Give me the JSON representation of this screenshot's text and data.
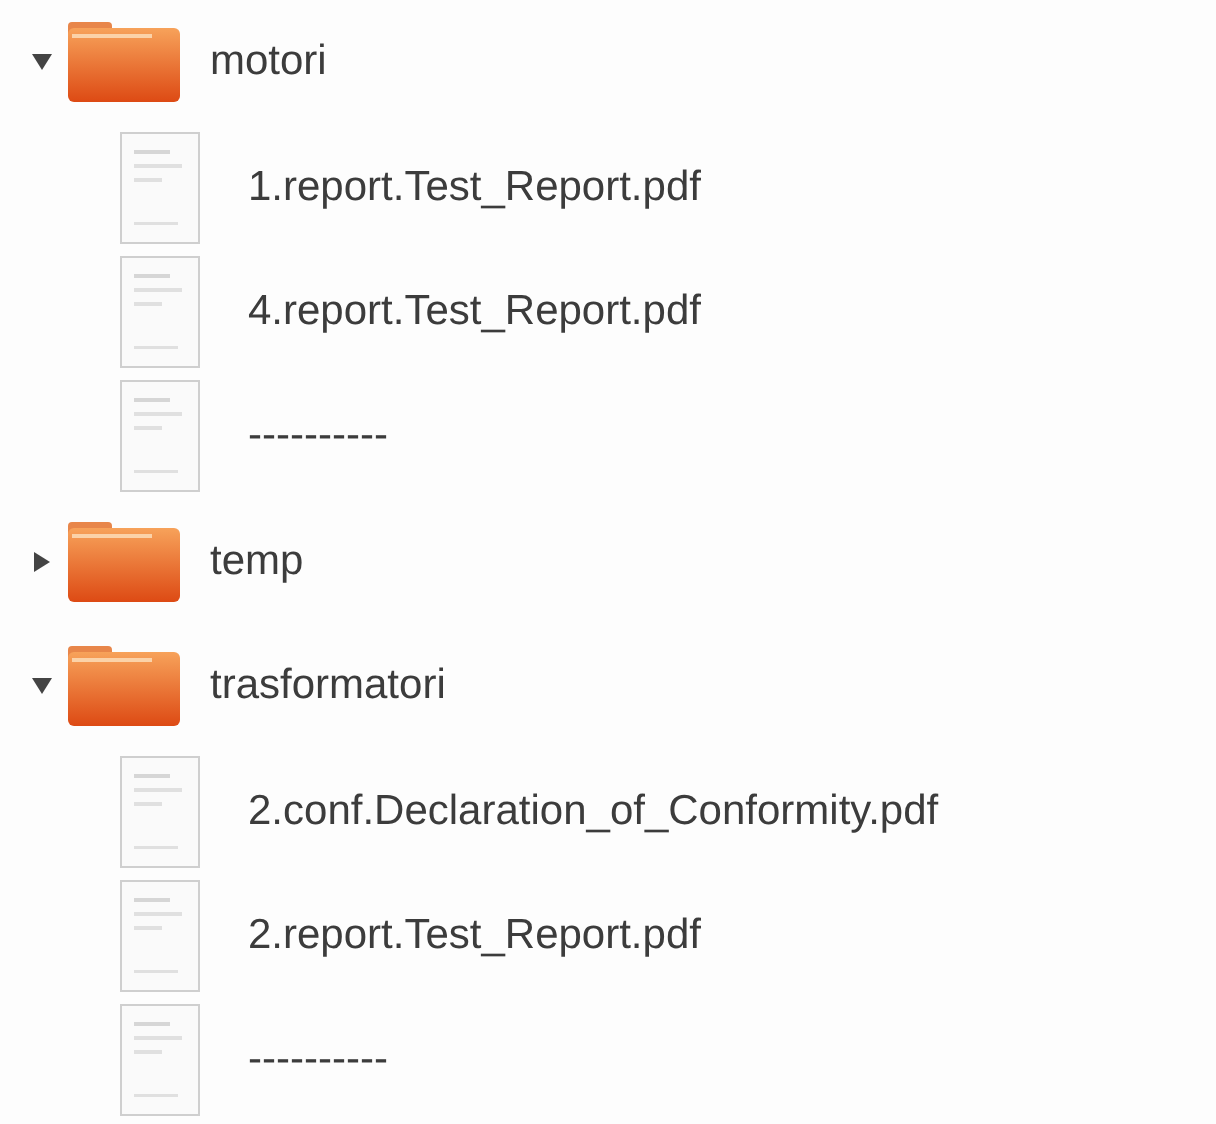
{
  "tree": [
    {
      "kind": "folder",
      "label": "motori",
      "expanded": true,
      "children": [
        {
          "kind": "file",
          "label": "1.report.Test_Report.pdf"
        },
        {
          "kind": "file",
          "label": "4.report.Test_Report.pdf"
        },
        {
          "kind": "file",
          "label": "----------"
        }
      ]
    },
    {
      "kind": "folder",
      "label": "temp",
      "expanded": false
    },
    {
      "kind": "folder",
      "label": "trasformatori",
      "expanded": true,
      "children": [
        {
          "kind": "file",
          "label": "2.conf.Declaration_of_Conformity.pdf"
        },
        {
          "kind": "file",
          "label": "2.report.Test_Report.pdf"
        },
        {
          "kind": "file",
          "label": "----------"
        }
      ]
    }
  ]
}
